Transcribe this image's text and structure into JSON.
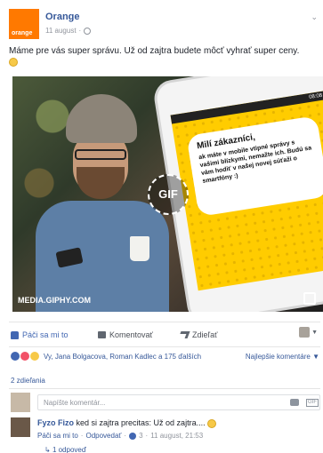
{
  "post": {
    "page_name": "Orange",
    "logo_text": "orange",
    "date": "11 august",
    "separator": "·",
    "text": "Máme pre vás super správu. Už od zajtra budete môcť vyhrať super ceny."
  },
  "media": {
    "phone_status": "08:08",
    "bubble_title": "Milí zákazníci,",
    "bubble_body": "ak máte v mobile vtipné správy s vašimi blízkymi, nemažte ich. Budú sa vám hodiť v našej novej súťaži o smartfóny :)",
    "gif_badge": "GIF",
    "source_label": "MEDIA.GIPHY.COM"
  },
  "actions": {
    "like": "Páči sa mi to",
    "comment": "Komentovať",
    "share": "Zdieľať",
    "profile_caret": "▼"
  },
  "reactions": {
    "text": "Vy, Jana Bolgacova, Roman Kadlec a 175 ďalších",
    "sort": "Najlepšie komentáre",
    "sort_caret": "▼"
  },
  "shares": "2 zdieľania",
  "comment_input": {
    "placeholder": "Napíšte komentár..."
  },
  "reply": {
    "author": "Fyzo Fizo",
    "text": "ked si zajtra precitas: Už od zajtra....",
    "like": "Páči sa mi to",
    "reply": "Odpovedať",
    "like_count": "3",
    "time": "11 august, 21:53",
    "more": "1 odpoveď"
  },
  "colors": {
    "brand": "#ff7900",
    "link": "#365899",
    "phone_screen": "#ffcc00"
  }
}
